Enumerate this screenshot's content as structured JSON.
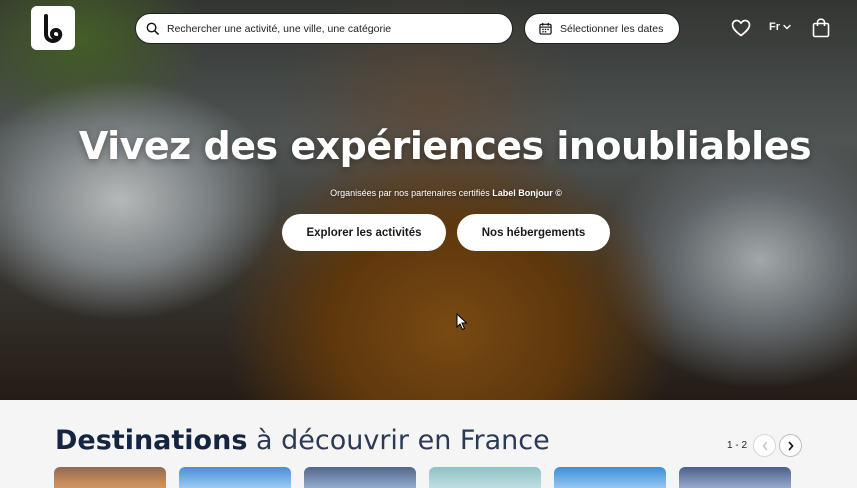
{
  "header": {
    "logo_icon": "bonjour-logo-icon",
    "search": {
      "placeholder": "Rechercher une activité, une ville, une catégorie"
    },
    "dates_label": "Sélectionner les dates",
    "language": "Fr"
  },
  "hero": {
    "title": "Vivez des expériences inoubliables",
    "subtitle_prefix": "Organisées par nos partenaires certifiés",
    "subtitle_brand": "Label Bonjour ©",
    "explore_button": "Explorer les activités",
    "accommodation_button": "Nos hébergements"
  },
  "destinations": {
    "title_strong": "Destinations",
    "title_rest": " à découvrir en France",
    "pager": "1 - 2"
  },
  "colors": {
    "title_navy": "#152440",
    "hero_overlay": "#000000"
  }
}
